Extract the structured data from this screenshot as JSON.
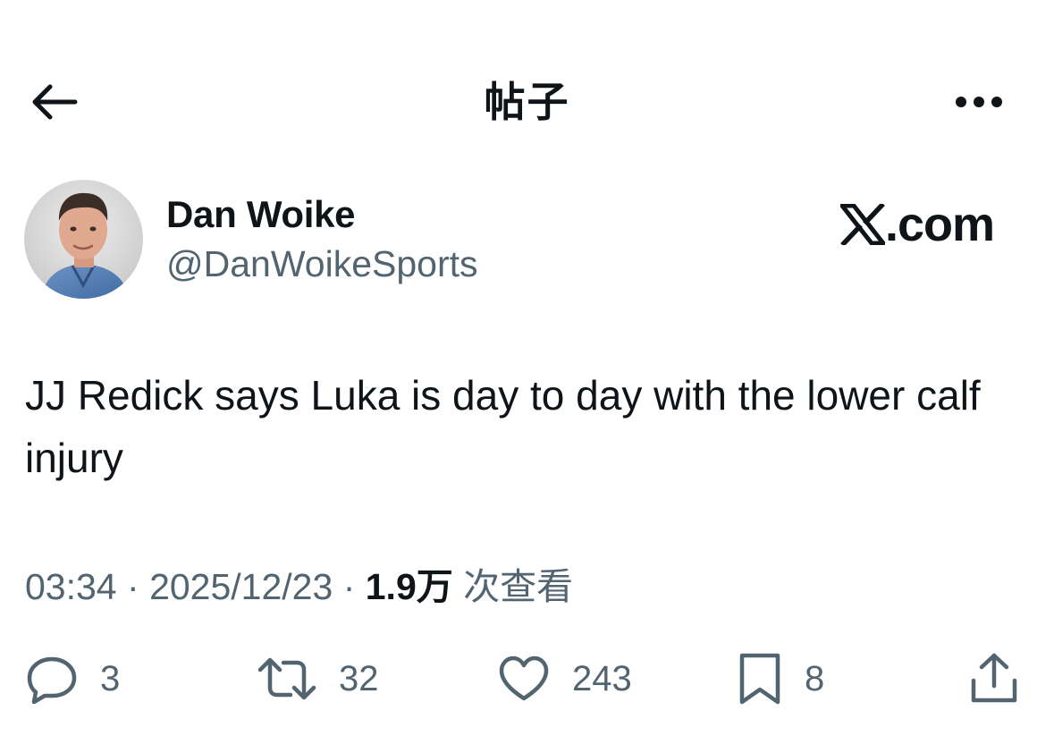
{
  "header": {
    "title": "帖子",
    "back_icon": "arrow-left-icon",
    "more_icon": "more-horizontal-icon"
  },
  "author": {
    "display_name": "Dan Woike",
    "handle": "@DanWoikeSports"
  },
  "brand": {
    "logo_icon": "x-logo-icon",
    "domain_suffix": ".com"
  },
  "tweet": {
    "text": "JJ Redick says Luka is day to day with the lower calf injury"
  },
  "meta": {
    "time": "03:34",
    "separator": "·",
    "date": "2025/12/23",
    "views_count": "1.9万",
    "views_label": "次查看"
  },
  "actions": {
    "replies": {
      "icon": "reply-icon",
      "count": "3"
    },
    "reposts": {
      "icon": "repost-icon",
      "count": "32"
    },
    "likes": {
      "icon": "heart-icon",
      "count": "243"
    },
    "bookmarks": {
      "icon": "bookmark-icon",
      "count": "8"
    },
    "share": {
      "icon": "share-icon"
    }
  },
  "colors": {
    "text_primary": "#0f1419",
    "text_secondary": "#536471",
    "background": "#ffffff"
  }
}
